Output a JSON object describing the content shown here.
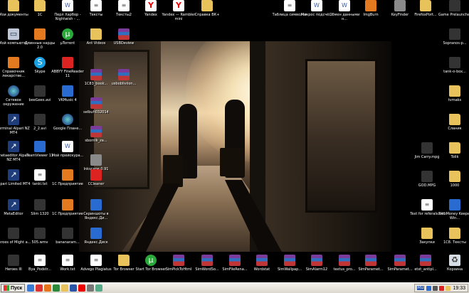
{
  "desktop": {
    "icons": [
      {
        "label": "Мои документы",
        "type": "g-folder",
        "icon": "folder-icon"
      },
      {
        "label": "1C",
        "type": "g-folder",
        "icon": "folder-icon"
      },
      {
        "label": "Перл Харбор - Nightwish - ...",
        "type": "g-doc",
        "icon": "document-icon"
      },
      {
        "label": "Тексты",
        "type": "g-text",
        "icon": "text-file-icon"
      },
      {
        "label": "Тексты2",
        "type": "g-text",
        "icon": "text-file-icon"
      },
      {
        "label": "Yandex",
        "type": "g-yandex",
        "icon": "yandex-browser-icon"
      },
      {
        "label": "Yandex — Rambler mini",
        "type": "g-yandex",
        "icon": "yandex-browser-icon"
      },
      {
        "label": "Справка ВК+",
        "type": "g-folder",
        "icon": "folder-icon"
      },
      {
        "label": "Таблица символов",
        "type": "g-text",
        "icon": "text-file-icon"
      },
      {
        "label": "Макрос подсчё...",
        "type": "g-doc",
        "icon": "document-icon"
      },
      {
        "label": "Обмен данными н...",
        "type": "g-doc",
        "icon": "document-icon"
      },
      {
        "label": "ImgBurn",
        "type": "g-orange",
        "icon": "disc-icon"
      },
      {
        "label": "KeyFinder",
        "type": "g-gray",
        "icon": "key-icon"
      },
      {
        "label": "FirefoxPort...",
        "type": "g-folder",
        "icon": "folder-icon"
      },
      {
        "label": "Game Prelauncher",
        "type": "g-dark",
        "icon": "game-icon"
      },
      {
        "label": "Мой компьютер",
        "type": "g-pc",
        "icon": "computer-icon"
      },
      {
        "label": "Длинные нарды 2.0",
        "type": "g-orange",
        "icon": "game-icon"
      },
      {
        "label": "µTorrent",
        "type": "g-green",
        "icon": "utorrent-icon"
      },
      {
        "label": "Ant Videos",
        "type": "g-folder",
        "icon": "folder-icon"
      },
      {
        "label": "USBDeview",
        "type": "g-rar",
        "icon": "archive-icon"
      },
      {
        "label": "Sopranos-p...",
        "type": "g-dark",
        "icon": "media-icon"
      },
      {
        "label": "Справочник лекарстве...",
        "type": "g-orange",
        "icon": "book-icon"
      },
      {
        "label": "Skype",
        "type": "g-skype",
        "icon": "skype-icon"
      },
      {
        "label": "ABBYY FineReader 11",
        "type": "g-red",
        "icon": "abbyy-icon"
      },
      {
        "label": "1C83_book...",
        "type": "g-rar",
        "icon": "archive-icon"
      },
      {
        "label": "usbobliviion...",
        "type": "g-rar",
        "icon": "archive-icon"
      },
      {
        "label": "tank-o-box...",
        "type": "g-dark",
        "icon": "game-icon"
      },
      {
        "label": "Сетевое окружение",
        "type": "g-globe",
        "icon": "network-icon"
      },
      {
        "label": "beeGees.avi",
        "type": "g-dark",
        "icon": "video-icon"
      },
      {
        "label": "VKMusic 4",
        "type": "g-blue",
        "icon": "vkmusic-icon"
      },
      {
        "label": "selbuh032014",
        "type": "g-rar",
        "icon": "archive-icon"
      },
      {
        "label": "tvmaks",
        "type": "g-folder",
        "icon": "folder-icon"
      },
      {
        "label": "terminal Alpari NZ MT4",
        "type": "g-mt",
        "icon": "metatrader-icon"
      },
      {
        "label": "2_2.avi",
        "type": "g-dark",
        "icon": "video-icon"
      },
      {
        "label": "Google Плане...",
        "type": "g-globe",
        "icon": "google-earth-icon"
      },
      {
        "label": "sbornik_za...",
        "type": "g-rar",
        "icon": "archive-icon"
      },
      {
        "label": "Сланик",
        "type": "g-folder",
        "icon": "folder-icon"
      },
      {
        "label": "metaeditor Alpari NZ MT4",
        "type": "g-mt",
        "icon": "metatrader-icon"
      },
      {
        "label": "TeamViewer 11",
        "type": "g-blue",
        "icon": "teamviewer-icon"
      },
      {
        "label": "Мой прейскура...",
        "type": "g-doc",
        "icon": "document-icon"
      },
      {
        "label": "Inkscape 0.91",
        "type": "g-gray",
        "icon": "inkscape-icon"
      },
      {
        "label": "Jim Carry.mpg",
        "type": "g-dark",
        "icon": "video-icon"
      },
      {
        "label": "Tolik",
        "type": "g-folder",
        "icon": "folder-icon"
      },
      {
        "label": "Alpari Limited MT4",
        "type": "g-mt",
        "icon": "metatrader-icon"
      },
      {
        "label": "tanki.txt",
        "type": "g-text",
        "icon": "text-file-icon"
      },
      {
        "label": "1С Предприятие",
        "type": "g-orange",
        "icon": "1c-icon"
      },
      {
        "label": "CCleaner",
        "type": "g-red",
        "icon": "ccleaner-icon"
      },
      {
        "label": "GOD.MPG",
        "type": "g-dark",
        "icon": "video-icon"
      },
      {
        "label": "1000",
        "type": "g-folder",
        "icon": "folder-icon"
      },
      {
        "label": "MetaEditor",
        "type": "g-mt",
        "icon": "metatrader-icon"
      },
      {
        "label": "Slim 1320",
        "type": "g-dark",
        "icon": "video-icon"
      },
      {
        "label": "1С Предприятие",
        "type": "g-orange",
        "icon": "1c-icon"
      },
      {
        "label": "Скриншоты в Яндекс.Ди...",
        "type": "g-blue",
        "icon": "screenshot-icon"
      },
      {
        "label": "Text for referals.txt",
        "type": "g-text",
        "icon": "text-file-icon"
      },
      {
        "label": "WebMoney Keeper Win...",
        "type": "g-blue",
        "icon": "webmoney-icon"
      },
      {
        "label": "Heroes of Might a...",
        "type": "g-dark",
        "icon": "game-icon"
      },
      {
        "label": "505.wmv",
        "type": "g-dark",
        "icon": "video-icon"
      },
      {
        "label": "bananaram...",
        "type": "g-dark",
        "icon": "video-icon"
      },
      {
        "label": "Яндекс.Диск",
        "type": "g-blue",
        "icon": "yandex-disk-icon"
      },
      {
        "label": "Закупки",
        "type": "g-folder",
        "icon": "folder-icon"
      },
      {
        "label": "1C8. Тексты",
        "type": "g-folder",
        "icon": "folder-icon"
      },
      {
        "label": "Heroes III",
        "type": "g-dark",
        "icon": "game-icon"
      },
      {
        "label": "Bya_Podstr...",
        "type": "g-text",
        "icon": "text-file-icon"
      },
      {
        "label": "Work.txt",
        "type": "g-text",
        "icon": "text-file-icon"
      },
      {
        "label": "Advego Plagiatus",
        "type": "g-text",
        "icon": "advego-icon"
      },
      {
        "label": "Tor Browser",
        "type": "g-folder",
        "icon": "folder-icon"
      },
      {
        "label": "Start Tor Browser",
        "type": "g-green",
        "icon": "tor-icon"
      },
      {
        "label": "SimPickToHtml",
        "type": "g-rar",
        "icon": "archive-icon"
      },
      {
        "label": "SimWordSo...",
        "type": "g-rar",
        "icon": "archive-icon"
      },
      {
        "label": "SimFileRena...",
        "type": "g-rar",
        "icon": "archive-icon"
      },
      {
        "label": "Wordstat",
        "type": "g-rar",
        "icon": "archive-icon"
      },
      {
        "label": "SimWallpap...",
        "type": "g-rar",
        "icon": "archive-icon"
      },
      {
        "label": "SimAlarm12",
        "type": "g-rar",
        "icon": "archive-icon"
      },
      {
        "label": "textus_pro...",
        "type": "g-rar",
        "icon": "archive-icon"
      },
      {
        "label": "SimParamet...",
        "type": "g-rar",
        "icon": "archive-icon"
      },
      {
        "label": "SimParamet...",
        "type": "g-rar",
        "icon": "archive-icon"
      },
      {
        "label": "etxt_antipl...",
        "type": "g-rar",
        "icon": "archive-icon"
      },
      {
        "label": "Корзина",
        "type": "g-bin",
        "icon": "recycle-bin-icon"
      }
    ]
  },
  "taskbar": {
    "start_label": "Пуск",
    "lang": "RU",
    "clock": "19:33",
    "quicklaunch": [
      {
        "icon": "show-desktop-icon",
        "color": "#3a7bd5"
      },
      {
        "icon": "opera-icon",
        "color": "#d33"
      },
      {
        "icon": "firefox-icon",
        "color": "#e8761c"
      },
      {
        "icon": "media-player-icon",
        "color": "#2a8a3a"
      },
      {
        "icon": "explorer-icon",
        "color": "#e8c25a"
      },
      {
        "icon": "word-icon",
        "color": "#2a55a8"
      },
      {
        "icon": "yandex-icon",
        "color": "#e00"
      },
      {
        "icon": "calc-icon",
        "color": "#777"
      },
      {
        "icon": "paint-icon",
        "color": "#5a8"
      }
    ],
    "tray_icons": [
      {
        "icon": "network-tray-icon",
        "color": "#2a6bd1"
      },
      {
        "icon": "volume-tray-icon",
        "color": "#555"
      },
      {
        "icon": "antivirus-tray-icon",
        "color": "#d22"
      },
      {
        "icon": "update-tray-icon",
        "color": "#e8c25a"
      }
    ]
  }
}
